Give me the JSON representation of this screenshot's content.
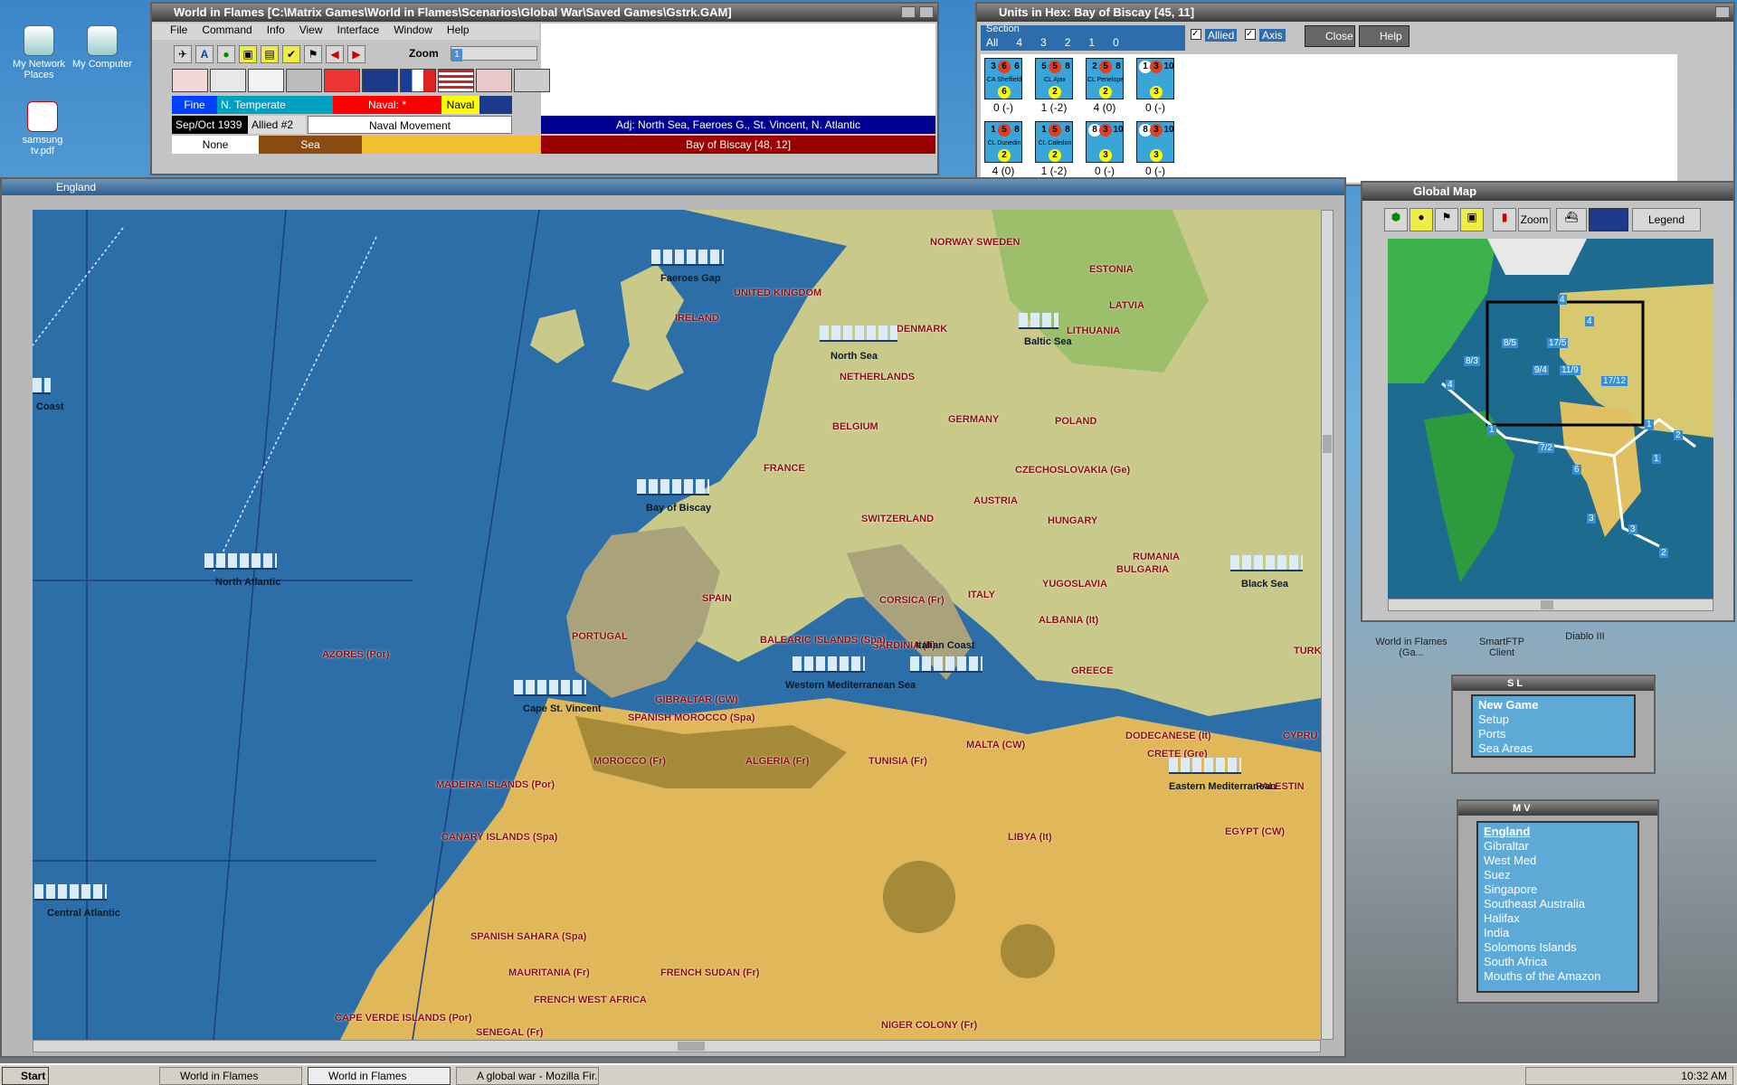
{
  "desktop": {
    "icons": [
      {
        "label": "My Network Places"
      },
      {
        "label": "My Computer"
      },
      {
        "label": "samsung tv.pdf"
      }
    ],
    "side_labels": [
      "World in Flames (Ga...",
      "SmartFTP Client",
      "Diablo III"
    ]
  },
  "main_window": {
    "title": "World in Flames [C:\\Matrix Games\\World in Flames\\Scenarios\\Global War\\Saved Games\\Gstrk.GAM]",
    "menu": [
      "File",
      "Command",
      "Info",
      "View",
      "Interface",
      "Window",
      "Help"
    ],
    "zoom_label": "Zoom",
    "zoom_value": "1",
    "status": {
      "weather": "Fine",
      "zone": "N. Temperate",
      "naval_state": "Naval: *",
      "naval_tag": "Naval",
      "date": "Sep/Oct 1939",
      "impulse": "Allied #2",
      "phase": "Naval Movement",
      "adjacent": "Adj: North Sea, Faeroes G., St. Vincent, N. Atlantic",
      "terrain_none": "None",
      "terrain_type": "Sea",
      "hex": "Bay of Biscay [48, 12]"
    }
  },
  "units_window": {
    "title": "Units in Hex: Bay of Biscay [45, 11]",
    "section_label": "Section",
    "section_options": [
      "All",
      "4",
      "3",
      "2",
      "1",
      "0"
    ],
    "allied_label": "Allied",
    "axis_label": "Axis",
    "close_label": "Close",
    "help_label": "Help",
    "units": [
      {
        "a": "3",
        "b": "6",
        "c": "6",
        "name": "CA Sheffield",
        "d": "6",
        "stack": "0 (-)"
      },
      {
        "a": "5",
        "b": "5",
        "c": "8",
        "name": "CL Ajax",
        "d": "2",
        "stack": "1 (-2)"
      },
      {
        "a": "2",
        "b": "5",
        "c": "8",
        "name": "CL Penelope",
        "d": "2",
        "stack": "4 (0)"
      },
      {
        "a": "1",
        "b": "3",
        "c": "10",
        "name": "",
        "d": "3",
        "stack": "0 (-)"
      },
      {
        "a": "1",
        "b": "5",
        "c": "8",
        "name": "CL Dunedin",
        "d": "2",
        "stack": "4 (0)"
      },
      {
        "a": "1",
        "b": "5",
        "c": "8",
        "name": "CL Caledon",
        "d": "2",
        "stack": "1 (-2)"
      },
      {
        "a": "8",
        "b": "3",
        "c": "10",
        "name": "",
        "d": "3",
        "stack": "0 (-)"
      },
      {
        "a": "8",
        "b": "3",
        "c": "10",
        "name": "",
        "d": "3",
        "stack": "0 (-)"
      }
    ]
  },
  "map_window": {
    "title": "England",
    "countries": [
      "NORWAY SWEDEN",
      "UNITED KINGDOM",
      "IRELAND",
      "DENMARK",
      "ESTONIA",
      "LATVIA",
      "LITHUANIA",
      "NETHERLANDS",
      "BELGIUM",
      "GERMANY",
      "POLAND",
      "FRANCE",
      "CZECHOSLOVAKIA (Ge)",
      "AUSTRIA",
      "SWITZERLAND",
      "HUNGARY",
      "RUMANIA",
      "BULGARIA",
      "YUGOSLAVIA",
      "ALBANIA (It)",
      "GREECE",
      "ITALY",
      "CORSICA (Fr)",
      "SARDINIA (It)",
      "SPAIN",
      "PORTUGAL",
      "BALEARIC ISLANDS (Spa)",
      "GIBRALTAR (CW)",
      "SPANISH MOROCCO (Spa)",
      "MOROCCO (Fr)",
      "ALGERIA (Fr)",
      "TUNISIA (Fr)",
      "MALTA (CW)",
      "LIBYA (It)",
      "EGYPT (CW)",
      "DODECANESE (It)",
      "CYPRU",
      "CRETE (Gre)",
      "AZORES (Por)",
      "MADEIRA ISLANDS (Por)",
      "CANARY ISLANDS (Spa)",
      "SPANISH SAHARA (Spa)",
      "MAURITANIA (Fr)",
      "FRENCH SUDAN (Fr)",
      "FRENCH WEST AFRICA",
      "CAPE VERDE ISLANDS (Por)",
      "SENEGAL (Fr)",
      "NIGER COLONY (Fr)",
      "TURK",
      "PALESTIN"
    ],
    "seas": [
      "Faeroes Gap",
      "North Sea",
      "Baltic Sea",
      "Bay of Biscay",
      "North Atlantic",
      "Coast",
      "Cape St. Vincent",
      "Western Mediterranean Sea",
      "Italian Coast",
      "Black Sea",
      "Eastern Mediterranean",
      "Central Atlantic"
    ]
  },
  "global_map": {
    "title": "Global Map",
    "zoom_label": "Zoom",
    "legend_label": "Legend",
    "box_numbers": [
      "4",
      "4",
      "8/5",
      "17/5",
      "8/3",
      "9/4",
      "11/9",
      "17/12",
      "4",
      "1",
      "7/2",
      "6",
      "3",
      "3",
      "2",
      "1",
      "2",
      "1"
    ]
  },
  "sl_panel": {
    "title": "S L",
    "items": [
      "New Game",
      "Setup",
      "Ports",
      "Sea Areas"
    ]
  },
  "mv_panel": {
    "title": "M V",
    "items": [
      "England",
      "Gibraltar",
      "West Med",
      "Suez",
      "Singapore",
      "Southeast Australia",
      "Halifax",
      "India",
      "Solomons Islands",
      "South Africa",
      "Mouths of the Amazon"
    ]
  },
  "taskbar": {
    "start": "Start",
    "tasks": [
      "World in Flames",
      "World in Flames",
      "A global war - Mozilla Fir..."
    ],
    "clock": "10:32 AM"
  },
  "colors": {
    "sea": "#2b6ea8",
    "land": "#c9c98a",
    "desert": "#e0b85a",
    "mountain": "#8d8d8d",
    "label": "#8a1010"
  }
}
